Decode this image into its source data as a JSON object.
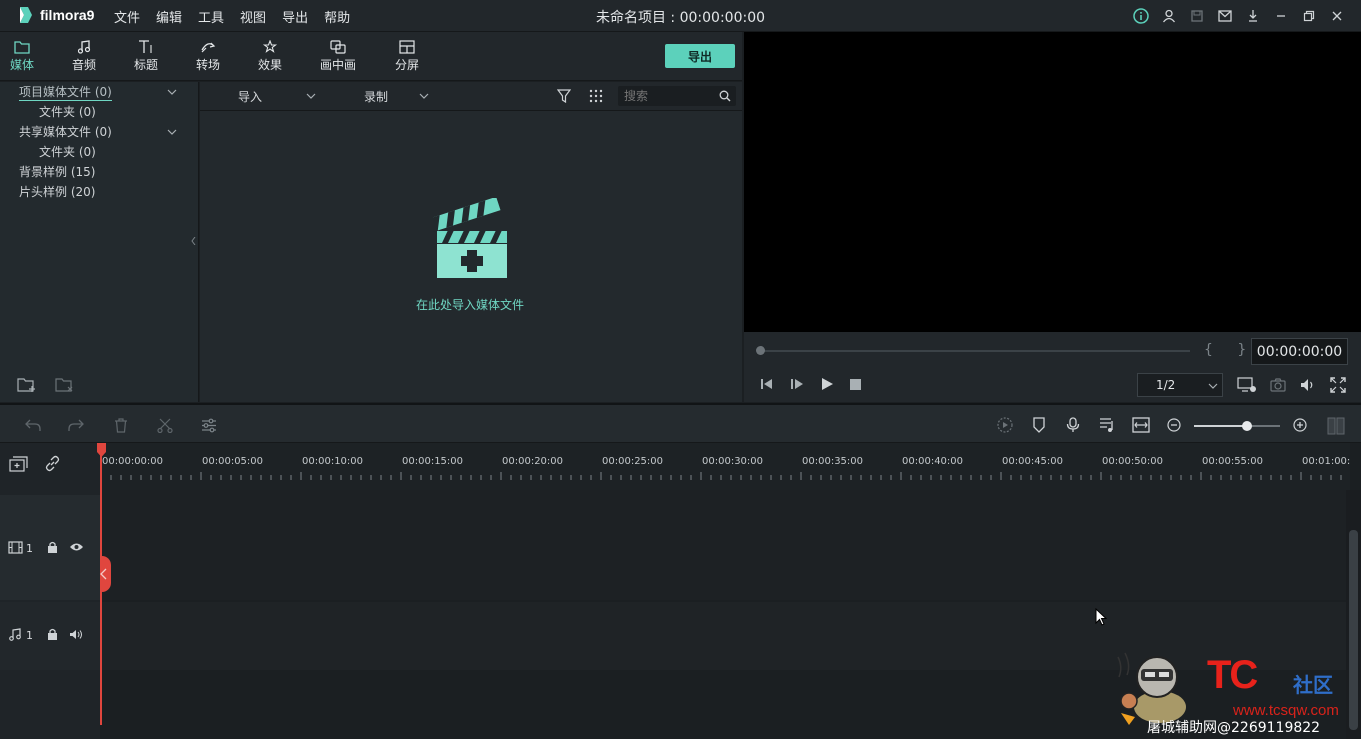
{
  "app": {
    "name": "filmora9",
    "project_title": "未命名项目 : 00:00:00:00"
  },
  "menu": [
    "文件",
    "编辑",
    "工具",
    "视图",
    "导出",
    "帮助"
  ],
  "tabs": [
    {
      "label": "媒体",
      "icon": "folder-icon"
    },
    {
      "label": "音频",
      "icon": "music-note-icon"
    },
    {
      "label": "标题",
      "icon": "text-icon"
    },
    {
      "label": "转场",
      "icon": "transition-icon"
    },
    {
      "label": "效果",
      "icon": "effects-icon"
    },
    {
      "label": "画中画",
      "icon": "pip-icon"
    },
    {
      "label": "分屏",
      "icon": "split-screen-icon"
    }
  ],
  "export_button": "导出",
  "media_tree": [
    "项目媒体文件 (0)",
    "文件夹 (0)",
    "共享媒体文件 (0)",
    "文件夹 (0)",
    "背景样例 (15)",
    "片头样例 (20)"
  ],
  "media_bar": {
    "import": "导入",
    "record": "录制",
    "search_placeholder": "搜索"
  },
  "media_empty_text": "在此处导入媒体文件",
  "preview": {
    "timecode": "00:00:00:00",
    "ratio": "1/2",
    "brackets": "{ }"
  },
  "ruler_labels": [
    "00:00:00:00",
    "00:00:05:00",
    "00:00:10:00",
    "00:00:15:00",
    "00:00:20:00",
    "00:00:25:00",
    "00:00:30:00",
    "00:00:35:00",
    "00:00:40:00",
    "00:00:45:00",
    "00:00:50:00",
    "00:00:55:00",
    "00:01:00:"
  ],
  "tracks": {
    "video_label": "1",
    "audio_label": "1"
  },
  "watermark": {
    "brand": "TC",
    "brand_suffix": "社区",
    "url": "www.tcsqw.com",
    "footer": "屠城辅助网@2269119822"
  },
  "colors": {
    "accent": "#5cd1bb",
    "playhead": "#e0463e",
    "bg": "#1b1f22"
  }
}
